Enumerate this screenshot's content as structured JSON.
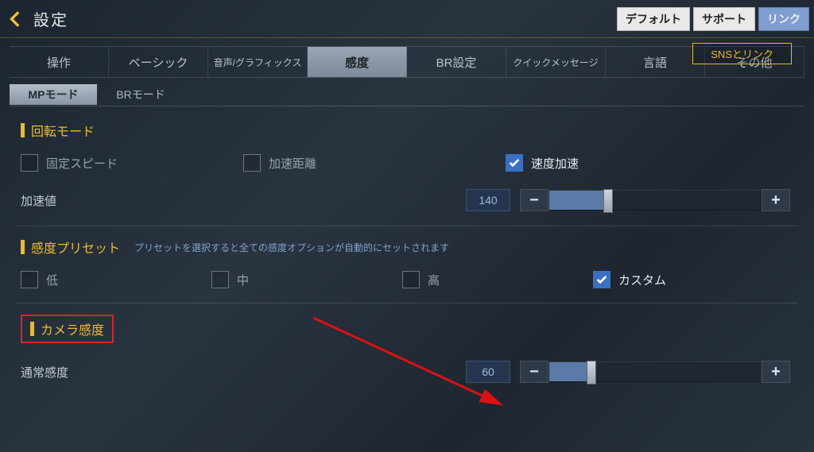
{
  "header": {
    "title": "設定",
    "buttons": {
      "default": "デフォルト",
      "support": "サポート",
      "link": "リンク"
    },
    "sns": "SNSとリンク"
  },
  "tabs": [
    "操作",
    "ベーシック",
    "音声/グラフィックス",
    "感度",
    "BR設定",
    "クイックメッセージ",
    "言語",
    "その他"
  ],
  "subtabs": {
    "mp": "MPモード",
    "br": "BRモード"
  },
  "rotation": {
    "title": "回転モード",
    "opts": {
      "fixed": "固定スピード",
      "distance": "加速距離",
      "accel": "速度加速"
    },
    "accel_label": "加速値",
    "accel_value": "140"
  },
  "preset": {
    "title": "感度プリセット",
    "note": "プリセットを選択すると全ての感度オプションが自動的にセットされます",
    "opts": {
      "low": "低",
      "mid": "中",
      "high": "高",
      "custom": "カスタム"
    }
  },
  "camera": {
    "title": "カメラ感度",
    "normal_label": "通常感度",
    "normal_value": "60"
  }
}
